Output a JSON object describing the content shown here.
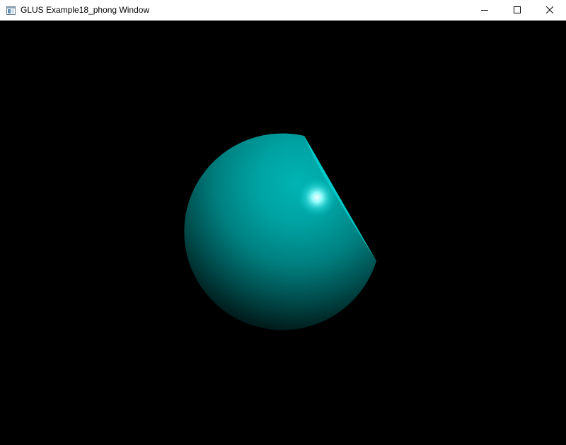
{
  "window": {
    "title": "GLUS Example18_phong Window",
    "icon": "app-window-icon",
    "controls": {
      "minimize_icon": "minimize-icon",
      "maximize_icon": "maximize-icon",
      "close_icon": "close-icon"
    }
  },
  "scene": {
    "background_color": "#000000",
    "object": "sphere",
    "object_color": "#00c8c8",
    "shading": "phong",
    "specular_highlight_color": "#e6ffff"
  }
}
